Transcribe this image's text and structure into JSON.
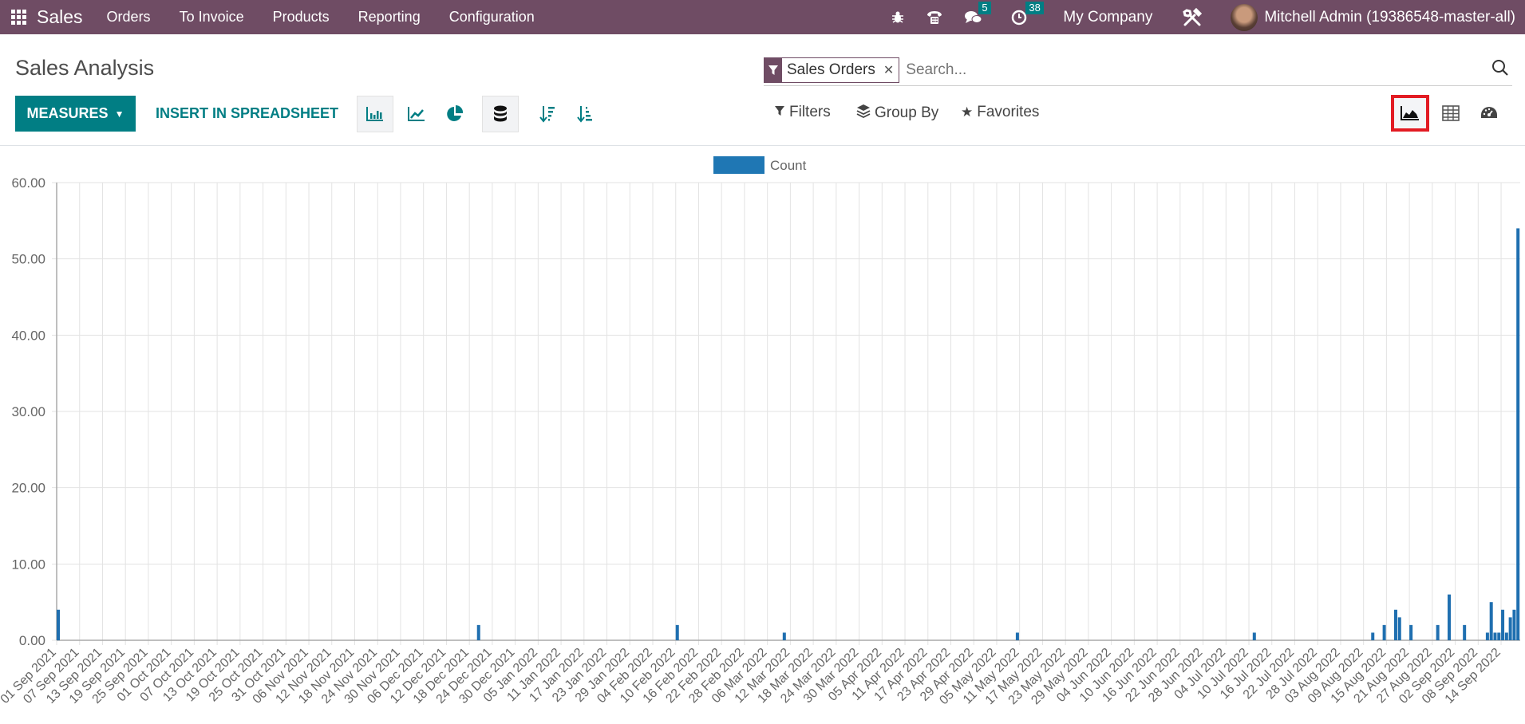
{
  "navbar": {
    "app_name": "Sales",
    "menus": [
      "Orders",
      "To Invoice",
      "Products",
      "Reporting",
      "Configuration"
    ],
    "messages_badge": "5",
    "activities_badge": "38",
    "company": "My Company",
    "user": "Mitchell Admin (19386548-master-all)"
  },
  "control_panel": {
    "title": "Sales Analysis",
    "search": {
      "facet": "Sales Orders",
      "placeholder": "Search..."
    },
    "measures_label": "MEASURES",
    "insert_label": "INSERT IN SPREADSHEET",
    "filters_label": "Filters",
    "groupby_label": "Group By",
    "favorites_label": "Favorites",
    "chart_modes": [
      "bar-chart",
      "line-chart",
      "pie-chart"
    ],
    "active_chart_mode": "bar-chart",
    "stacked": true,
    "views": [
      "graph",
      "pivot",
      "dashboard"
    ],
    "active_view": "graph"
  },
  "colors": {
    "brand": "#6f4c64",
    "accent": "#017e84",
    "bar": "#1f6fb0",
    "highlight": "#e21b23"
  },
  "chart_data": {
    "type": "bar",
    "title": "",
    "xlabel": "",
    "ylabel": "",
    "ylim": [
      0,
      60
    ],
    "yticks": [
      "0.00",
      "10.00",
      "20.00",
      "30.00",
      "40.00",
      "50.00",
      "60.00"
    ],
    "grid": true,
    "legend": {
      "position": "top-center",
      "entries": [
        "Count"
      ]
    },
    "x_start": "2021-09-01",
    "x_end": "2022-09-19",
    "tick_labels": [
      "01 Sep 2021",
      "07 Sep 2021",
      "13 Sep 2021",
      "19 Sep 2021",
      "25 Sep 2021",
      "01 Oct 2021",
      "07 Oct 2021",
      "13 Oct 2021",
      "19 Oct 2021",
      "25 Oct 2021",
      "31 Oct 2021",
      "06 Nov 2021",
      "12 Nov 2021",
      "18 Nov 2021",
      "24 Nov 2021",
      "30 Nov 2021",
      "06 Dec 2021",
      "12 Dec 2021",
      "18 Dec 2021",
      "24 Dec 2021",
      "30 Dec 2021",
      "05 Jan 2022",
      "11 Jan 2022",
      "17 Jan 2022",
      "23 Jan 2022",
      "29 Jan 2022",
      "04 Feb 2022",
      "10 Feb 2022",
      "16 Feb 2022",
      "22 Feb 2022",
      "28 Feb 2022",
      "06 Mar 2022",
      "12 Mar 2022",
      "18 Mar 2022",
      "24 Mar 2022",
      "30 Mar 2022",
      "05 Apr 2022",
      "11 Apr 2022",
      "17 Apr 2022",
      "23 Apr 2022",
      "29 Apr 2022",
      "05 May 2022",
      "11 May 2022",
      "17 May 2022",
      "23 May 2022",
      "29 May 2022",
      "04 Jun 2022",
      "10 Jun 2022",
      "16 Jun 2022",
      "22 Jun 2022",
      "28 Jun 2022",
      "04 Jul 2022",
      "10 Jul 2022",
      "16 Jul 2022",
      "22 Jul 2022",
      "28 Jul 2022",
      "03 Aug 2022",
      "09 Aug 2022",
      "15 Aug 2022",
      "21 Aug 2022",
      "27 Aug 2022",
      "02 Sep 2022",
      "08 Sep 2022",
      "14 Sep 2022"
    ],
    "series": [
      {
        "name": "Count",
        "points": [
          {
            "x": "2021-09-01",
            "y": 4
          },
          {
            "x": "2021-12-20",
            "y": 2
          },
          {
            "x": "2022-02-10",
            "y": 2
          },
          {
            "x": "2022-03-10",
            "y": 1
          },
          {
            "x": "2022-05-10",
            "y": 1
          },
          {
            "x": "2022-07-11",
            "y": 1
          },
          {
            "x": "2022-08-11",
            "y": 1
          },
          {
            "x": "2022-08-14",
            "y": 2
          },
          {
            "x": "2022-08-17",
            "y": 4
          },
          {
            "x": "2022-08-18",
            "y": 3
          },
          {
            "x": "2022-08-21",
            "y": 2
          },
          {
            "x": "2022-08-28",
            "y": 2
          },
          {
            "x": "2022-08-31",
            "y": 6
          },
          {
            "x": "2022-09-04",
            "y": 2
          },
          {
            "x": "2022-09-10",
            "y": 1
          },
          {
            "x": "2022-09-11",
            "y": 5
          },
          {
            "x": "2022-09-12",
            "y": 1
          },
          {
            "x": "2022-09-13",
            "y": 1
          },
          {
            "x": "2022-09-14",
            "y": 4
          },
          {
            "x": "2022-09-15",
            "y": 1
          },
          {
            "x": "2022-09-16",
            "y": 3
          },
          {
            "x": "2022-09-17",
            "y": 4
          },
          {
            "x": "2022-09-18",
            "y": 54
          }
        ]
      }
    ]
  }
}
